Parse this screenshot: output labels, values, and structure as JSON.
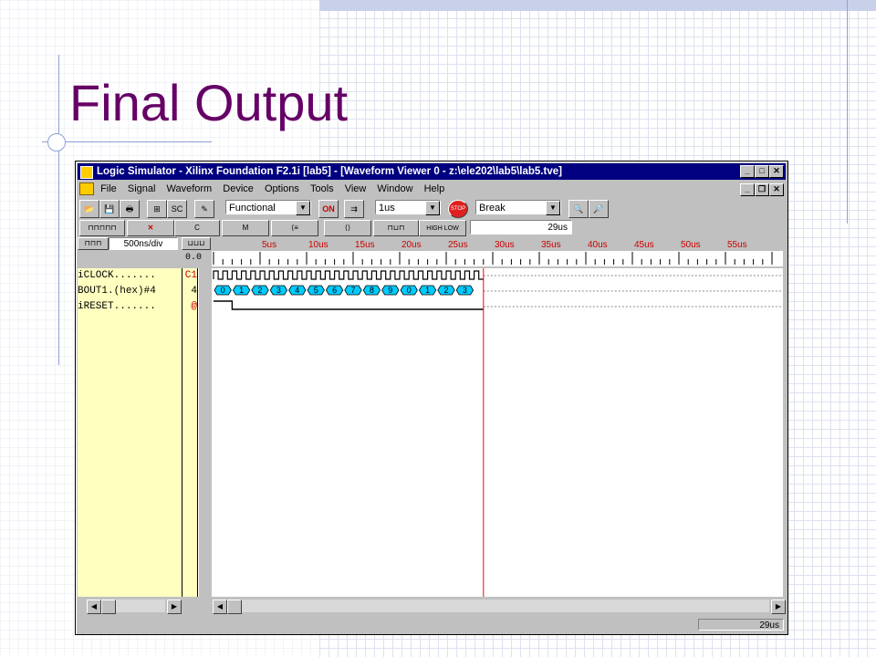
{
  "slide": {
    "title": "Final Output"
  },
  "window": {
    "title": "Logic Simulator - Xilinx Foundation F2.1i [lab5] - [Waveform Viewer 0  -  z:\\ele202\\lab5\\lab5.tve]",
    "controls": {
      "minimize": "_",
      "maximize": "□",
      "close": "✕"
    },
    "doc_controls": {
      "minimize": "_",
      "restore": "❐",
      "close": "✕"
    }
  },
  "menu": [
    "File",
    "Signal",
    "Waveform",
    "Device",
    "Options",
    "Tools",
    "View",
    "Window",
    "Help"
  ],
  "toolbar": {
    "mode": "Functional",
    "step": "1us",
    "break_mode": "Break",
    "on_label": "ON",
    "sc_label": "SC",
    "stop_label": "STOP"
  },
  "toolbar2": {
    "high_low": "HIGH LOW",
    "time_readout": "29us",
    "c_label": "C",
    "m_label": "M"
  },
  "ruler": {
    "scale": "500ns/div",
    "origin": "0.0",
    "ticks": [
      "5us",
      "10us",
      "15us",
      "20us",
      "25us",
      "30us",
      "35us",
      "40us",
      "45us",
      "50us",
      "55us"
    ],
    "cursor_time_us": 29
  },
  "signals": [
    {
      "type": "i",
      "name": "CLOCK.......",
      "value": "C1",
      "value_color": "#cc0000"
    },
    {
      "type": "B",
      "name": "OUT1.(hex)#4",
      "value": "4",
      "value_color": "#000000"
    },
    {
      "type": "i",
      "name": "RESET.......",
      "value": "@",
      "value_color": "#cc0000"
    }
  ],
  "bus_values": [
    "0",
    "1",
    "2",
    "3",
    "4",
    "5",
    "6",
    "7",
    "8",
    "9",
    "0",
    "1",
    "2",
    "3"
  ],
  "status": {
    "time": "29us"
  },
  "colors": {
    "title": "#660066",
    "window_title_bg": "#000080",
    "signal_panel": "#ffffc0",
    "bus_fill": "#00ccff",
    "cursor": "#ff0000"
  }
}
